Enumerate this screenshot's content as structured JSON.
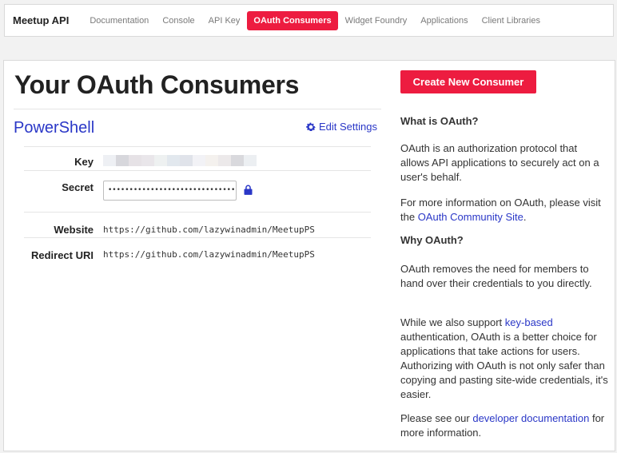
{
  "nav": {
    "brand": "Meetup API",
    "links": [
      {
        "label": "Documentation"
      },
      {
        "label": "Console"
      },
      {
        "label": "API Key"
      },
      {
        "label": "OAuth Consumers",
        "active": true
      },
      {
        "label": "Widget Foundry"
      },
      {
        "label": "Applications"
      },
      {
        "label": "Client Libraries"
      }
    ]
  },
  "main": {
    "title": "Your OAuth Consumers",
    "consumer": {
      "name": "PowerShell",
      "edit_label": "Edit Settings",
      "key_label": "Key",
      "secret_label": "Secret",
      "secret_value": "••••••••••••••••••••••••••••••••",
      "website_label": "Website",
      "website_value": "https://github.com/lazywinadmin/MeetupPS",
      "redirect_label": "Redirect URI",
      "redirect_value": "https://github.com/lazywinadmin/MeetupPS"
    }
  },
  "sidebar": {
    "create_button": "Create New Consumer",
    "what_heading": "What is OAuth?",
    "what_p1": "OAuth is an authorization protocol that allows API applications to securely act on a user's behalf.",
    "what_p2_pre": "For more information on OAuth, please visit the ",
    "what_p2_link": "OAuth Community Site",
    "what_p2_post": ".",
    "why_heading": "Why OAuth?",
    "why_p1": "OAuth removes the need for members to hand over their credentials to you directly.",
    "why_p2_pre": "While we also support ",
    "why_p2_link": "key-based",
    "why_p2_post": " authentication, OAuth is a better choice for applications that take actions for users. Authorizing with OAuth is not only safer than copying and pasting site-wide credentials, it's easier.",
    "why_p3_pre": "Please see our ",
    "why_p3_link": "developer documentation",
    "why_p3_post": " for more information."
  },
  "colors": {
    "accent": "#ed1c40",
    "link": "#2a37c7"
  },
  "icons": [
    "gear-icon",
    "lock-icon"
  ]
}
